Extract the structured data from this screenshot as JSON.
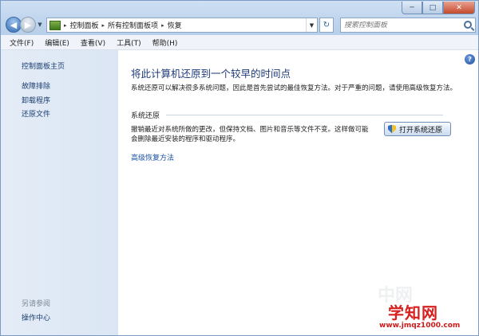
{
  "window": {
    "controls": {
      "minimize": "─",
      "maximize": "□",
      "close": "✕"
    }
  },
  "navigation": {
    "back_glyph": "◀",
    "forward_glyph": "▶",
    "dropdown_glyph": "▼",
    "refresh_glyph": "↻"
  },
  "address": {
    "crumbs": [
      "控制面板",
      "所有控制面板项",
      "恢复"
    ],
    "separator": "▸"
  },
  "search": {
    "placeholder": "搜索控制面板"
  },
  "menu": {
    "items": [
      "文件(F)",
      "编辑(E)",
      "查看(V)",
      "工具(T)",
      "帮助(H)"
    ]
  },
  "sidebar": {
    "home": "控制面板主页",
    "links": [
      "故障排除",
      "卸载程序",
      "还原文件"
    ],
    "see_also_label": "另请参阅",
    "see_also_links": [
      "操作中心"
    ]
  },
  "main": {
    "help_glyph": "?",
    "title": "将此计算机还原到一个较早的时间点",
    "description": "系统还原可以解决很多系统问题，因此是首先尝试的最佳恢复方法。对于严重的问题，请使用高级恢复方法。",
    "section": {
      "title": "系统还原",
      "line1": "撤销最近对系统所做的更改，但保持文档、图片和音乐等文件不变。这样做可能",
      "line2": "会删除最近安装的程序和驱动程序。",
      "button_label": "打开系统还原"
    },
    "advanced_link": "高级恢复方法"
  },
  "watermark": {
    "logo": "学知网",
    "url": "www.jmqz1000.com",
    "ghost": "中网"
  },
  "colors": {
    "link": "#1a3d6e",
    "title": "#1e3b78",
    "sidebar_bg": "#dbe6f4",
    "watermark": "#d62020"
  }
}
